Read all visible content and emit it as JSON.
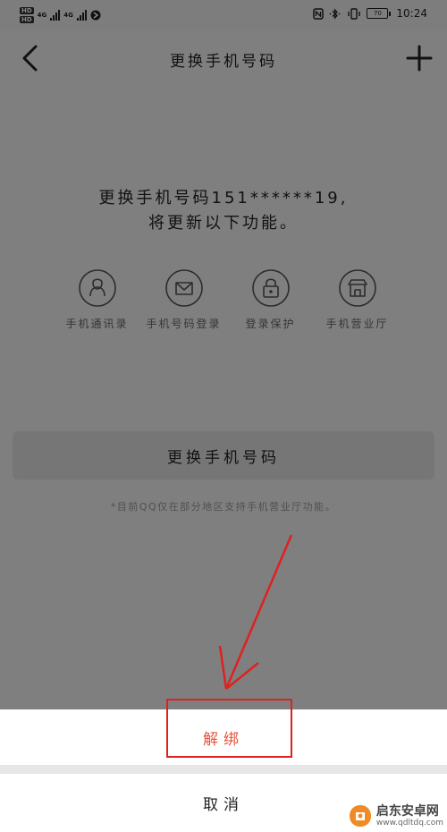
{
  "status_bar": {
    "sim1": "HD",
    "sim2": "HD",
    "network1": "4G",
    "network2": "4G",
    "battery": "70",
    "time": "10:24"
  },
  "header": {
    "title": "更换手机号码",
    "back_icon": "back-arrow-icon",
    "add_icon": "plus-icon"
  },
  "main": {
    "description_line1": "更换手机号码151******19,",
    "description_line2": "将更新以下功能。",
    "features": [
      {
        "label": "手机通讯录",
        "icon": "contact-icon"
      },
      {
        "label": "手机号码登录",
        "icon": "mail-icon"
      },
      {
        "label": "登录保护",
        "icon": "lock-icon"
      },
      {
        "label": "手机营业厅",
        "icon": "store-icon"
      }
    ],
    "change_button": "更换手机号码",
    "note": "*目前QQ仅在部分地区支持手机营业厅功能。"
  },
  "sheet": {
    "unbind_label": "解绑",
    "cancel_label": "取消"
  },
  "watermark": {
    "title": "启东安卓网",
    "url": "www.qdltdq.com"
  },
  "colors": {
    "unbind": "#e5533a",
    "highlight": "#e02020"
  }
}
